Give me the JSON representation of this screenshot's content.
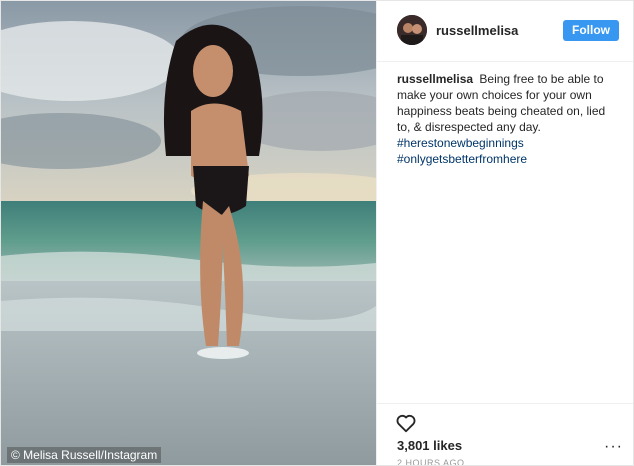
{
  "post": {
    "username": "russellmelisa",
    "follow_label": "Follow",
    "caption": {
      "username": "russellmelisa",
      "text": "Being free to be able to make your own choices for your own happiness beats being cheated on, lied to, & disrespected any day.",
      "hashtags": [
        "#herestonewbeginnings",
        "#onlygetsbetterfromhere"
      ]
    },
    "likes": "3,801 likes",
    "time": "2 HOURS AGO",
    "more_label": "···"
  },
  "photo": {
    "credit": "© Melisa Russell/Instagram"
  },
  "icons": {
    "heart": "heart-icon",
    "more": "more-options-icon"
  },
  "colors": {
    "follow_button": "#3897f0",
    "hashtag": "#003569"
  }
}
